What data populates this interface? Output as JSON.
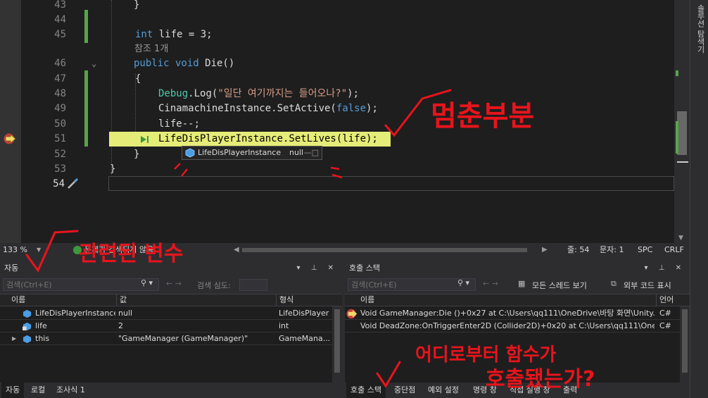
{
  "editor": {
    "lines": [
      {
        "num": "43",
        "code": "}"
      },
      {
        "num": "44",
        "code": ""
      },
      {
        "num": "45",
        "code_kw": "int",
        "code_rest": " life = 3;"
      },
      {
        "codelens": "참조 1개"
      },
      {
        "num": "46",
        "code_kw": "public void",
        "code_rest": " Die()"
      },
      {
        "num": "47",
        "code": "{"
      },
      {
        "num": "48",
        "code_ty": "Debug",
        "code_m": ".Log(",
        "code_str": "\"일단 여기까지는 들어오나?\"",
        "code_end": ");"
      },
      {
        "num": "49",
        "code_pl": "CinamachineInstance.SetActive(",
        "code_kw": "false",
        "code_end": ");"
      },
      {
        "num": "50",
        "code": "life--;"
      },
      {
        "num": "51",
        "code": "LifeDisPlayerInstance.SetLives(life);"
      },
      {
        "num": "52",
        "code": "}"
      },
      {
        "num": "53",
        "code": "}"
      },
      {
        "num": "54",
        "code": ""
      }
    ],
    "datatip": {
      "name": "LifeDisPlayerInstance",
      "value": "null"
    }
  },
  "status": {
    "zoom": "133 %",
    "issues": "문제가 검색되지 않음",
    "line": "줄: 54",
    "col": "문자: 1",
    "ins": "SPC",
    "eol": "CRLF"
  },
  "side_tab": "솔루션 탐색기",
  "autos": {
    "title": "자동",
    "search_placeholder": "검색(Ctrl+E)",
    "search_depth": "검색 심도:",
    "columns": [
      "이름",
      "값",
      "형식"
    ],
    "rows": [
      {
        "name": "LifeDisPlayerInstance",
        "value": "null",
        "type": "LifeDisPlayer"
      },
      {
        "name": "life",
        "value": "2",
        "type": "int"
      },
      {
        "name": "this",
        "value": "\"GameManager (GameManager)\"",
        "type": "GameMana..."
      }
    ],
    "tabs": [
      "자동",
      "로컬",
      "조사식 1"
    ]
  },
  "callstack": {
    "title": "호출 스택",
    "search_placeholder": "검색(Ctrl+E)",
    "show_threads": "모든 스레드 보기",
    "external_code": "외부 코드 표시",
    "columns": [
      "이름",
      "언어"
    ],
    "rows": [
      {
        "name": "Void GameManager:Die ()+0x27 at C:\\Users\\qq111\\OneDrive\\바탕 화면\\Unity...",
        "lang": "C#"
      },
      {
        "name": "Void DeadZone:OnTriggerEnter2D (Collider2D)+0x20 at C:\\Users\\qq111\\OneDr...",
        "lang": "C#"
      }
    ],
    "tabs": [
      "호출 스택",
      "중단점",
      "예외 설정",
      "명령 창",
      "직접 실행 창",
      "출력"
    ]
  },
  "annotations": {
    "stop_point": "멈춘부분",
    "related_vars": "관련된 변수",
    "call_line1": "어디로부터 함수가",
    "call_line2": "호출됐는가?"
  },
  "colors": {
    "accent_red": "#e8141c",
    "current_line": "#e6ec78",
    "change_bar": "#57a64a"
  }
}
